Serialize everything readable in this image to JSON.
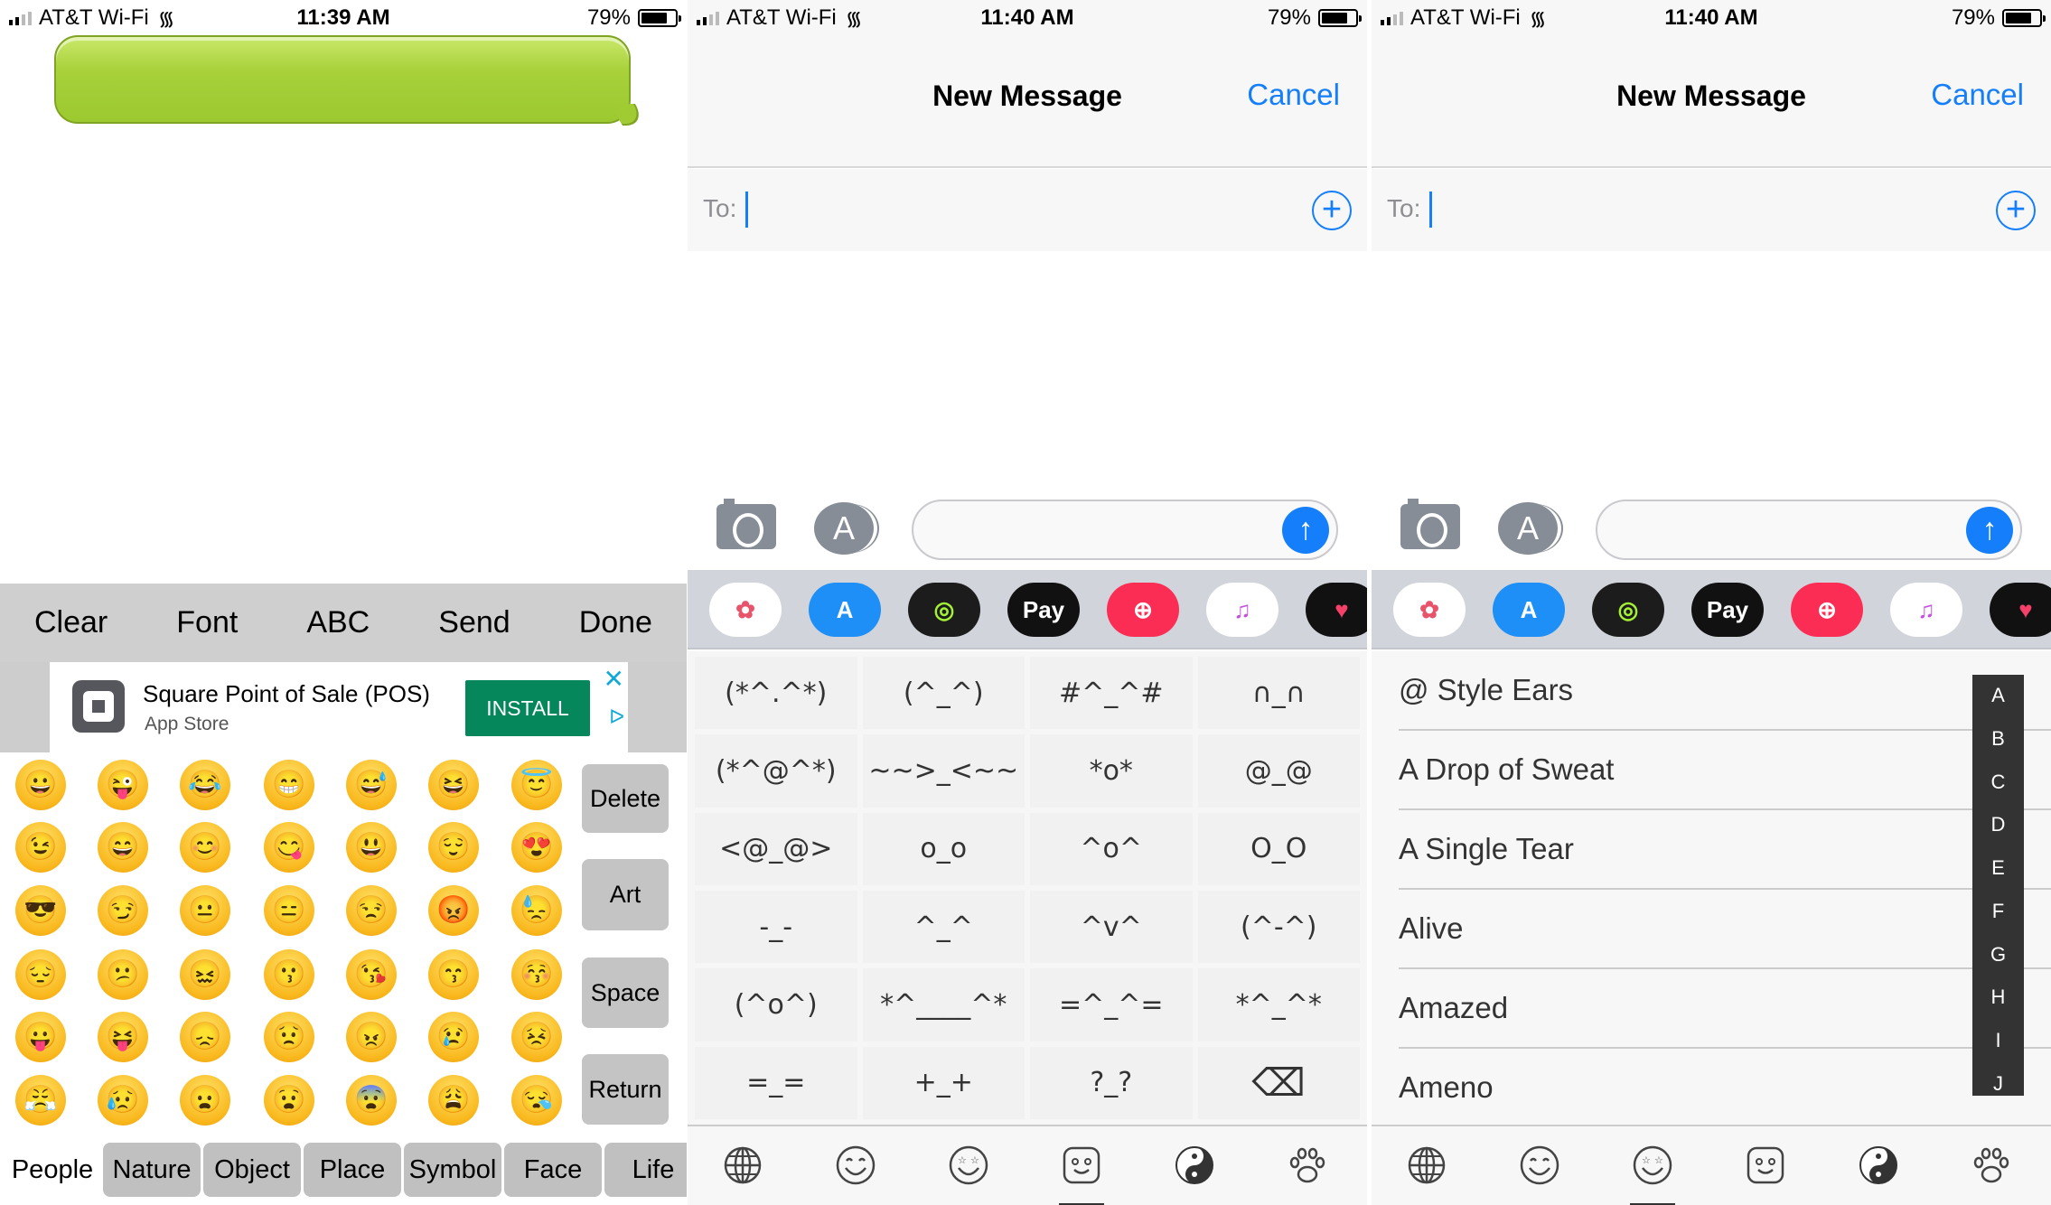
{
  "panels": [
    {
      "status": {
        "carrier": "AT&T Wi-Fi",
        "time": "11:39 AM",
        "battery": "79%"
      }
    },
    {
      "status": {
        "carrier": "AT&T Wi-Fi",
        "time": "11:40 AM",
        "battery": "79%"
      }
    },
    {
      "status": {
        "carrier": "AT&T Wi-Fi",
        "time": "11:40 AM",
        "battery": "79%"
      }
    }
  ],
  "keyboard1": {
    "toolbar": [
      "Clear",
      "Font",
      "ABC",
      "Send",
      "Done"
    ],
    "ad": {
      "title": "Square Point of Sale (POS)",
      "subtitle": "App Store",
      "install": "INSTALL",
      "close": "✕",
      "adchoices": "ᐅ"
    },
    "emojis": [
      [
        "😀",
        "😜",
        "😂",
        "😁",
        "😅",
        "😆",
        "😇"
      ],
      [
        "😉",
        "😄",
        "😊",
        "😋",
        "😃",
        "😌",
        "😍"
      ],
      [
        "😎",
        "😏",
        "😐",
        "😑",
        "😒",
        "😡",
        "😓"
      ],
      [
        "😔",
        "😕",
        "😖",
        "😗",
        "😘",
        "😙",
        "😚"
      ],
      [
        "😛",
        "😝",
        "😞",
        "😟",
        "😠",
        "😢",
        "😣"
      ],
      [
        "😤",
        "😥",
        "😦",
        "😧",
        "😨",
        "😩",
        "😪"
      ]
    ],
    "side_buttons": [
      "Delete",
      "Art",
      "Space",
      "Return"
    ],
    "categories": [
      "People",
      "Nature",
      "Object",
      "Place",
      "Symbol",
      "Face",
      "Life"
    ],
    "selected_category": "People",
    "bubble_color": "#a8d13a"
  },
  "compose": {
    "title": "New Message",
    "cancel": "Cancel",
    "to_label": "To:",
    "plus": "+",
    "send_arrow": "↑",
    "accent": "#147efb",
    "apps": [
      {
        "name": "photos",
        "label": "✿",
        "bg": "#ffffff",
        "fg": "#e8556b"
      },
      {
        "name": "app-store",
        "label": "A",
        "bg": "#1e8ff7",
        "fg": "#ffffff"
      },
      {
        "name": "activity",
        "label": "◎",
        "bg": "#1c1c1c",
        "fg": "#a4f236"
      },
      {
        "name": "apple-pay",
        "label": " Pay",
        "bg": "#111111",
        "fg": "#ffffff"
      },
      {
        "name": "image-search",
        "label": "⊕",
        "bg": "#fc2d55",
        "fg": "#ffffff"
      },
      {
        "name": "music",
        "label": "♫",
        "bg": "#ffffff",
        "fg": "#c450e0"
      },
      {
        "name": "heart-stickers",
        "label": "♥",
        "bg": "#111111",
        "fg": "#f5406a"
      }
    ],
    "bottom_icons": [
      "globe",
      "smile",
      "star-eyes-face",
      "square-face",
      "yin-yang",
      "paw"
    ]
  },
  "kaomoji": {
    "items": [
      "(*^.^*)",
      "(^_^)",
      "#^_^#",
      "∩_∩",
      "(*^@^*)",
      "~~>_<~~",
      "*o*",
      "@_@",
      "<@_@>",
      "o_o",
      "^o^",
      "O_O",
      "-_-",
      "^_^",
      "^v^",
      "(^-^)",
      "(^o^)",
      "*^____^*",
      "=^_^=",
      "*^_^*",
      "=_=",
      "+_+",
      "?_?"
    ],
    "delete_icon": "⌫",
    "selected_tab": 3
  },
  "categories_list": {
    "items": [
      "@ Style Ears",
      "A Drop of Sweat",
      "A Single Tear",
      "Alive",
      "Amazed",
      "Ameno"
    ],
    "index": [
      "A",
      "B",
      "C",
      "D",
      "E",
      "F",
      "G",
      "H",
      "I",
      "J"
    ],
    "selected_tab": 2
  }
}
